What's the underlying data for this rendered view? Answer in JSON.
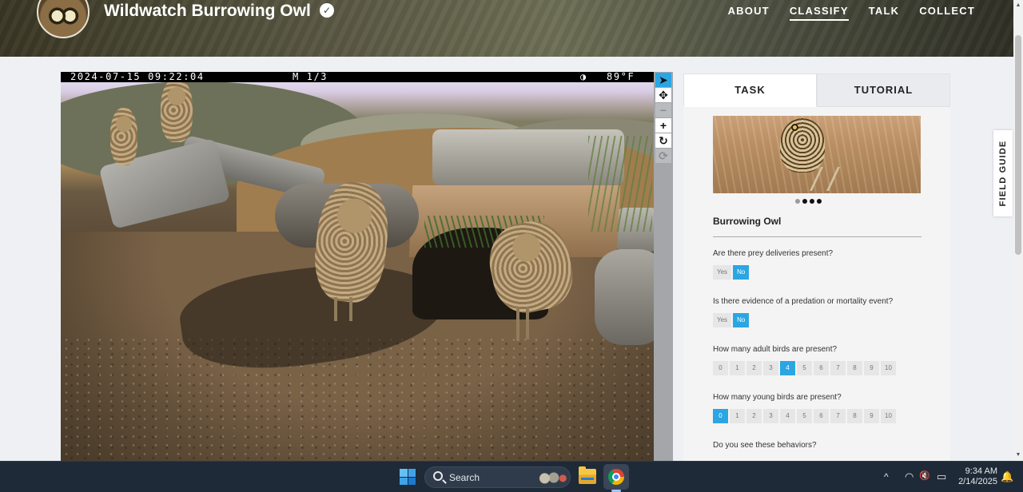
{
  "header": {
    "project_title": "Wildwatch Burrowing Owl",
    "verified_glyph": "✓",
    "nav": [
      "ABOUT",
      "CLASSIFY",
      "TALK",
      "COLLECT"
    ],
    "active_nav": "CLASSIFY"
  },
  "subject": {
    "timestamp": "2024-07-15 09:22:04",
    "frame": "M 1/3",
    "moon_glyph": "◑",
    "temperature": "89°F"
  },
  "image_tools": [
    {
      "name": "pointer-tool",
      "icon": "pointer-icon",
      "glyph": "➤",
      "state": "active"
    },
    {
      "name": "move-tool",
      "icon": "move-icon",
      "glyph": "✥",
      "state": "normal"
    },
    {
      "name": "zoom-out-tool",
      "icon": "minus-icon",
      "glyph": "−",
      "state": "disabled"
    },
    {
      "name": "zoom-in-tool",
      "icon": "plus-icon",
      "glyph": "+",
      "state": "normal"
    },
    {
      "name": "rotate-tool",
      "icon": "rotate-icon",
      "glyph": "↻",
      "state": "normal"
    },
    {
      "name": "reset-tool",
      "icon": "reset-icon",
      "glyph": "⟳",
      "state": "disabled"
    }
  ],
  "panel": {
    "tabs": [
      "TASK",
      "TUTORIAL"
    ],
    "active_tab": "TASK",
    "species_name": "Burrowing Owl",
    "carousel": {
      "count": 4,
      "active_index": 0
    },
    "questions": [
      {
        "text": "Are there prey deliveries present?",
        "options": [
          "Yes",
          "No"
        ],
        "selected": "No"
      },
      {
        "text": "Is there evidence of a predation or mortality event?",
        "options": [
          "Yes",
          "No"
        ],
        "selected": "No"
      },
      {
        "text": "How many adult birds are present?",
        "options": [
          "0",
          "1",
          "2",
          "3",
          "4",
          "5",
          "6",
          "7",
          "8",
          "9",
          "10"
        ],
        "selected": "4"
      },
      {
        "text": "How many young birds are present?",
        "options": [
          "0",
          "1",
          "2",
          "3",
          "4",
          "5",
          "6",
          "7",
          "8",
          "9",
          "10"
        ],
        "selected": "0"
      },
      {
        "text": "Do you see these behaviors?",
        "options": [],
        "selected": null
      }
    ]
  },
  "field_guide_label": "FIELD GUIDE",
  "scrollbar": {
    "up_glyph": "▲",
    "down_glyph": "▼"
  },
  "taskbar": {
    "search_label": "Search",
    "tray_chevron": "^",
    "tray_icons": [
      {
        "name": "wifi-icon",
        "glyph": "◠"
      },
      {
        "name": "volume-muted-icon",
        "glyph": "🔇"
      },
      {
        "name": "battery-icon",
        "glyph": "▭"
      }
    ],
    "time": "9:34 AM",
    "date": "2/14/2025",
    "bell_glyph": "🔔"
  },
  "colors": {
    "accent": "#2ba6e3",
    "taskbar": "#1f2a38"
  }
}
